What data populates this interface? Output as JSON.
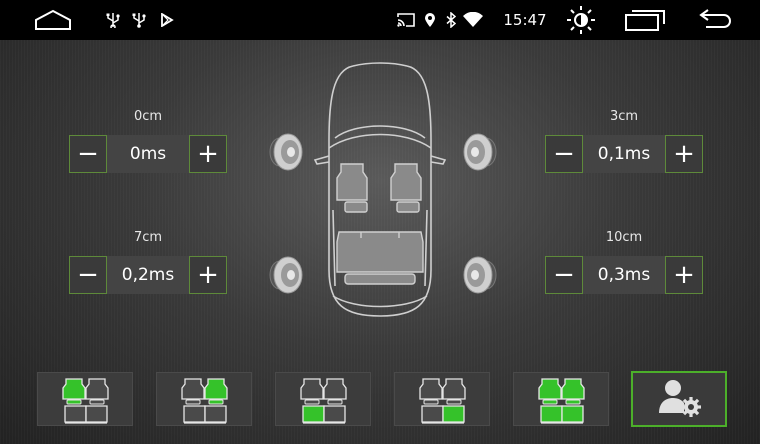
{
  "status_bar": {
    "time": "15:47",
    "icons": [
      "home-icon",
      "usb-icon",
      "usb-icon",
      "play-store-icon",
      "cast-icon",
      "location-icon",
      "bluetooth-icon",
      "wifi-icon",
      "brightness-icon",
      "recent-apps-icon",
      "back-icon"
    ]
  },
  "delays": {
    "front_left": {
      "distance": "0cm",
      "delay": "0ms"
    },
    "front_right": {
      "distance": "3cm",
      "delay": "0,1ms"
    },
    "rear_left": {
      "distance": "7cm",
      "delay": "0,2ms"
    },
    "rear_right": {
      "distance": "10cm",
      "delay": "0,3ms"
    }
  },
  "buttons": {
    "minus": "−",
    "plus": "+"
  },
  "presets": [
    {
      "name": "front-left-seat-preset",
      "active": [
        "front_left"
      ]
    },
    {
      "name": "front-right-seat-preset",
      "active": [
        "front_right"
      ]
    },
    {
      "name": "rear-left-seat-preset",
      "active": [
        "rear_left"
      ]
    },
    {
      "name": "rear-right-seat-preset",
      "active": [
        "rear_right"
      ]
    },
    {
      "name": "all-seats-preset",
      "active": [
        "front_left",
        "front_right",
        "rear_left",
        "rear_right"
      ]
    }
  ],
  "colors": {
    "accent": "#4caf2a",
    "active_seat": "#35c22a",
    "border": "#5e8a3a"
  }
}
